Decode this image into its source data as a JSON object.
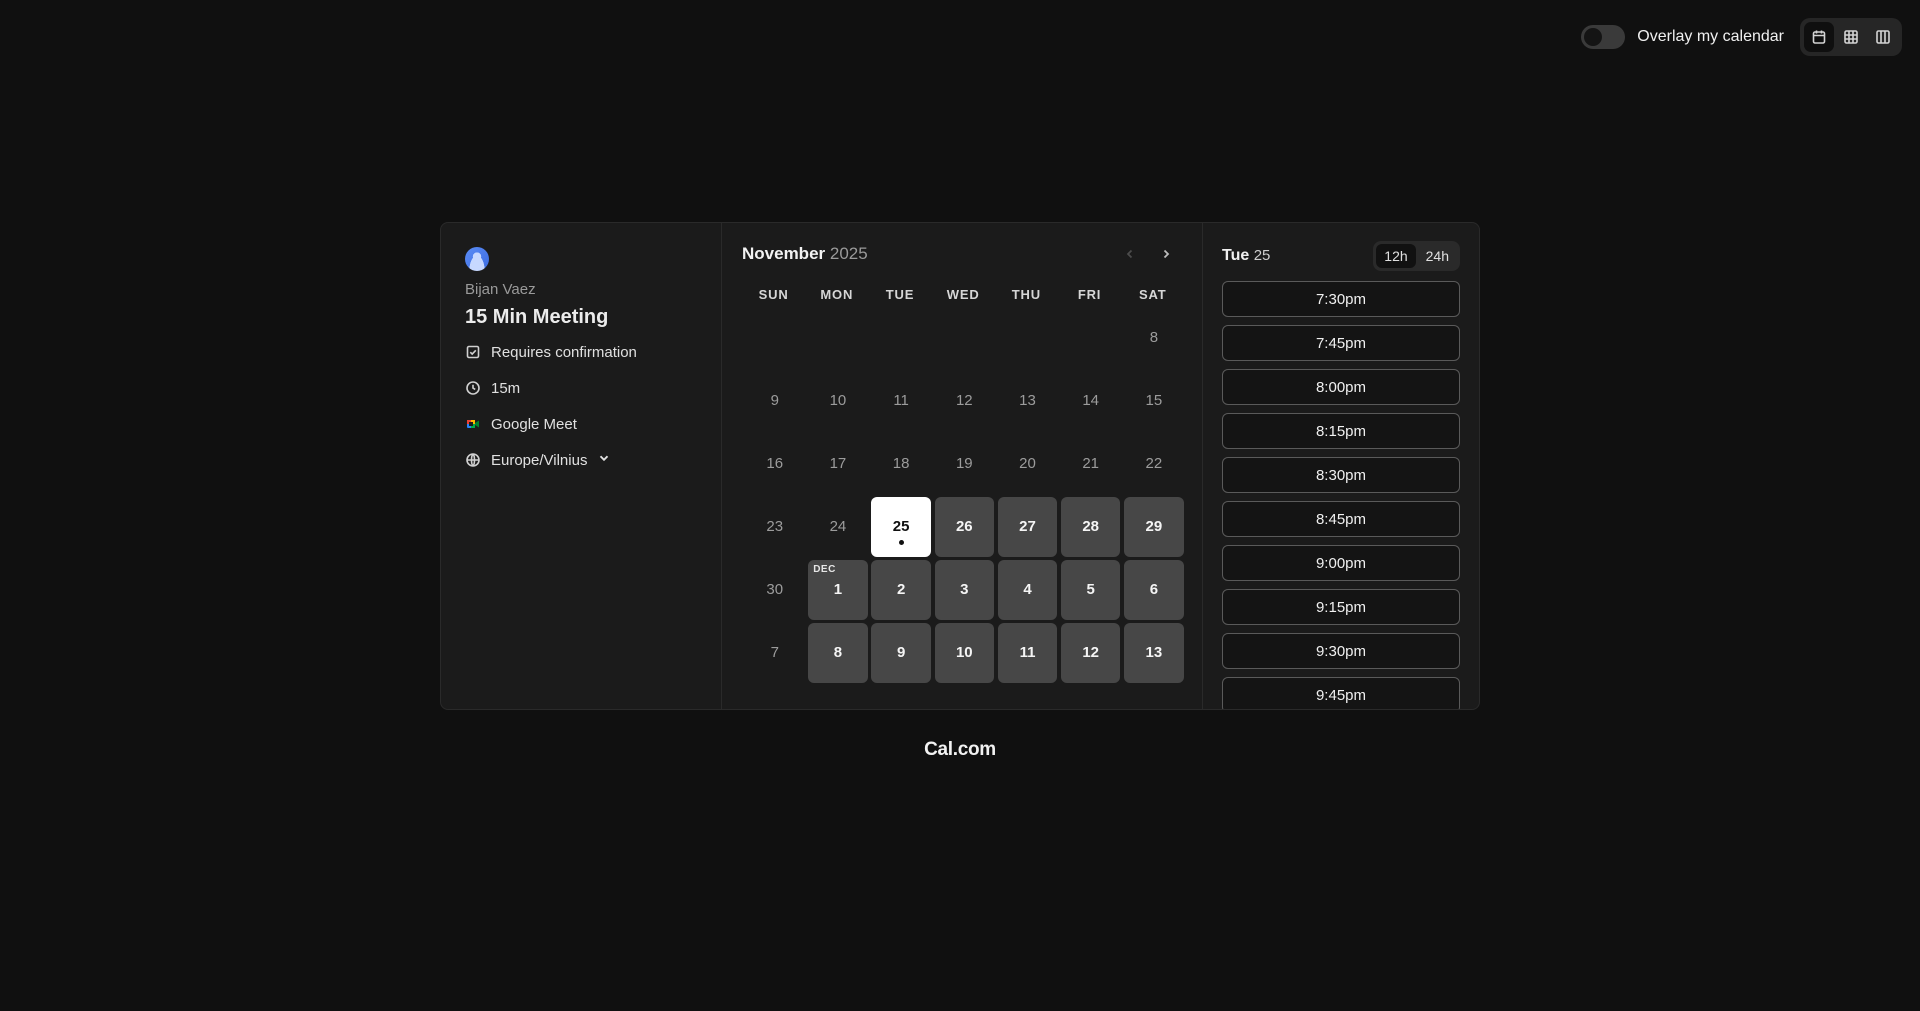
{
  "topbar": {
    "overlay_label": "Overlay my calendar",
    "overlay_on": false,
    "view_icons": [
      "calendar-icon",
      "grid-icon",
      "columns-icon"
    ]
  },
  "meta": {
    "host_name": "Bijan Vaez",
    "event_title": "15 Min Meeting",
    "requires_confirmation": "Requires confirmation",
    "duration": "15m",
    "location": "Google Meet",
    "timezone": "Europe/Vilnius"
  },
  "calendar": {
    "month": "November",
    "year": "2025",
    "weekdays": [
      "SUN",
      "MON",
      "TUE",
      "WED",
      "THU",
      "FRI",
      "SAT"
    ],
    "next_month_tag": "DEC",
    "days": [
      {
        "label": "",
        "state": "empty"
      },
      {
        "label": "",
        "state": "empty"
      },
      {
        "label": "",
        "state": "empty"
      },
      {
        "label": "",
        "state": "empty"
      },
      {
        "label": "",
        "state": "empty"
      },
      {
        "label": "",
        "state": "empty"
      },
      {
        "label": "8",
        "state": "disabled"
      },
      {
        "label": "9",
        "state": "disabled"
      },
      {
        "label": "10",
        "state": "disabled"
      },
      {
        "label": "11",
        "state": "disabled"
      },
      {
        "label": "12",
        "state": "disabled"
      },
      {
        "label": "13",
        "state": "disabled"
      },
      {
        "label": "14",
        "state": "disabled"
      },
      {
        "label": "15",
        "state": "disabled"
      },
      {
        "label": "16",
        "state": "disabled"
      },
      {
        "label": "17",
        "state": "disabled"
      },
      {
        "label": "18",
        "state": "disabled"
      },
      {
        "label": "19",
        "state": "disabled"
      },
      {
        "label": "20",
        "state": "disabled"
      },
      {
        "label": "21",
        "state": "disabled"
      },
      {
        "label": "22",
        "state": "disabled"
      },
      {
        "label": "23",
        "state": "disabled"
      },
      {
        "label": "24",
        "state": "disabled"
      },
      {
        "label": "25",
        "state": "selected"
      },
      {
        "label": "26",
        "state": "available"
      },
      {
        "label": "27",
        "state": "available"
      },
      {
        "label": "28",
        "state": "available"
      },
      {
        "label": "29",
        "state": "available"
      },
      {
        "label": "30",
        "state": "disabled"
      },
      {
        "label": "1",
        "state": "available",
        "tag": "DEC"
      },
      {
        "label": "2",
        "state": "available"
      },
      {
        "label": "3",
        "state": "available"
      },
      {
        "label": "4",
        "state": "available"
      },
      {
        "label": "5",
        "state": "available"
      },
      {
        "label": "6",
        "state": "available"
      },
      {
        "label": "7",
        "state": "disabled"
      },
      {
        "label": "8",
        "state": "available"
      },
      {
        "label": "9",
        "state": "available"
      },
      {
        "label": "10",
        "state": "available"
      },
      {
        "label": "11",
        "state": "available"
      },
      {
        "label": "12",
        "state": "available"
      },
      {
        "label": "13",
        "state": "available"
      }
    ]
  },
  "slots": {
    "day_name": "Tue",
    "day_num": "25",
    "format_12h": "12h",
    "format_24h": "24h",
    "active_format": "12h",
    "times": [
      "7:30pm",
      "7:45pm",
      "8:00pm",
      "8:15pm",
      "8:30pm",
      "8:45pm",
      "9:00pm",
      "9:15pm",
      "9:30pm",
      "9:45pm"
    ]
  },
  "brand": "Cal.com"
}
